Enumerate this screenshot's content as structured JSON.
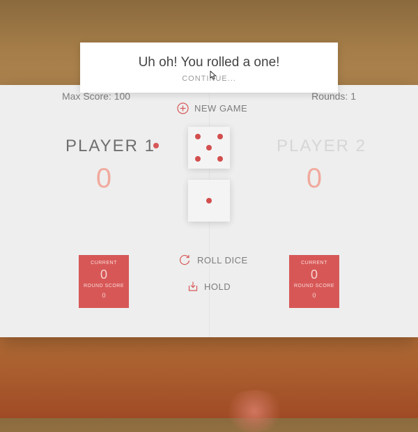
{
  "game": {
    "max_score_label": "Max Score: 100",
    "rounds_label": "Rounds: 1",
    "new_game_label": "NEW GAME",
    "roll_dice_label": "ROLL DICE",
    "hold_label": "HOLD",
    "players": [
      {
        "name": "PLAYER 1",
        "score": "0",
        "current_label": "CURRENT",
        "current_value": "0",
        "round_label": "ROUND SCORE",
        "round_value": "0",
        "active": true
      },
      {
        "name": "PLAYER 2",
        "score": "0",
        "current_label": "CURRENT",
        "current_value": "0",
        "round_label": "ROUND SCORE",
        "round_value": "0",
        "active": false
      }
    ],
    "dice": [
      5,
      1
    ]
  },
  "modal": {
    "message": "Uh oh! You rolled a one!",
    "continue_label": "CONTINUE..."
  },
  "colors": {
    "accent": "#d13a3a",
    "pip": "#cc2f2f",
    "panel": "#ececec"
  },
  "icons": [
    "add-circle-icon",
    "refresh-icon",
    "download-icon",
    "cursor-icon"
  ]
}
